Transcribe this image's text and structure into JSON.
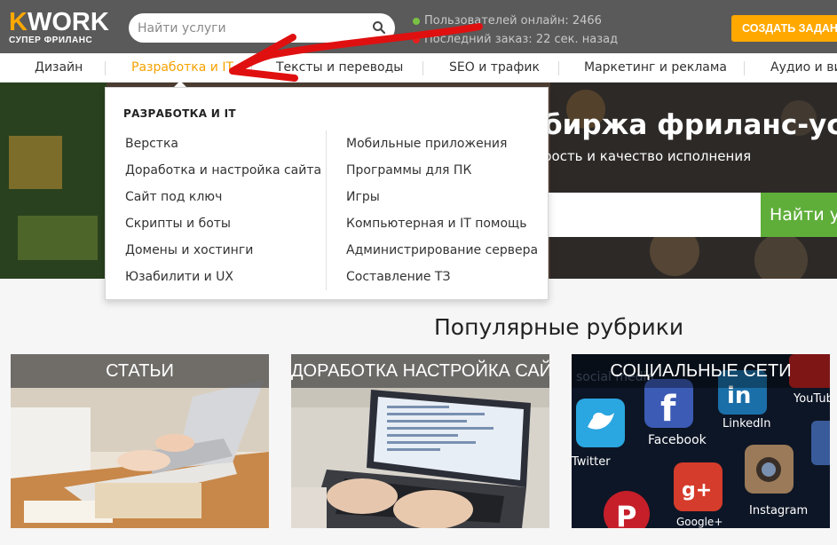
{
  "header": {
    "logo_text": "KWORK",
    "logo_sub": "СУПЕР ФРИЛАНС",
    "search_placeholder": "Найти услуги",
    "stats": {
      "online": "Пользователей онлайн: 2466",
      "last_order": "Последний заказ: 22 сек. назад"
    },
    "create_button": "СОЗДАТЬ ЗАДАНИЕ"
  },
  "nav": {
    "items": [
      {
        "label": "Дизайн"
      },
      {
        "label": "Разработка и IT"
      },
      {
        "label": "Тексты и переводы"
      },
      {
        "label": "SEO и трафик"
      },
      {
        "label": "Маркетинг и реклама"
      },
      {
        "label": "Аудио и видео"
      }
    ],
    "active_index": 1
  },
  "hero": {
    "title": "биржа фриланс-услуг",
    "subtitle": "рость и качество исполнения",
    "search_button": "Найти услуги"
  },
  "dropdown": {
    "title": "РАЗРАБОТКА И IT",
    "left": [
      "Верстка",
      "Доработка и настройка сайта",
      "Сайт под ключ",
      "Скрипты и боты",
      "Домены и хостинги",
      "Юзабилити и UX"
    ],
    "right": [
      "Мобильные приложения",
      "Программы для ПК",
      "Игры",
      "Компьютерная и IT помощь",
      "Администрирование сервера",
      "Составление ТЗ"
    ]
  },
  "popular": {
    "title": "Популярные рубрики",
    "cards": [
      {
        "label": "СТАТЬИ"
      },
      {
        "label": "ДОРАБОТКА НАСТРОЙКА САЙТА"
      },
      {
        "label": "СОЦИАЛЬНЫЕ СЕТИ"
      }
    ],
    "social_logos": {
      "twitter": "Twitter",
      "facebook": "Facebook",
      "linkedin": "LinkedIn",
      "youtube": "YouTube",
      "gplus": "Google+",
      "instagram": "Instagram",
      "social_media": "social media"
    }
  },
  "colors": {
    "accent": "#ffa800",
    "header_bg": "#5a5a5a",
    "green": "#5fae3a",
    "annotation_arrow": "#e01010"
  }
}
